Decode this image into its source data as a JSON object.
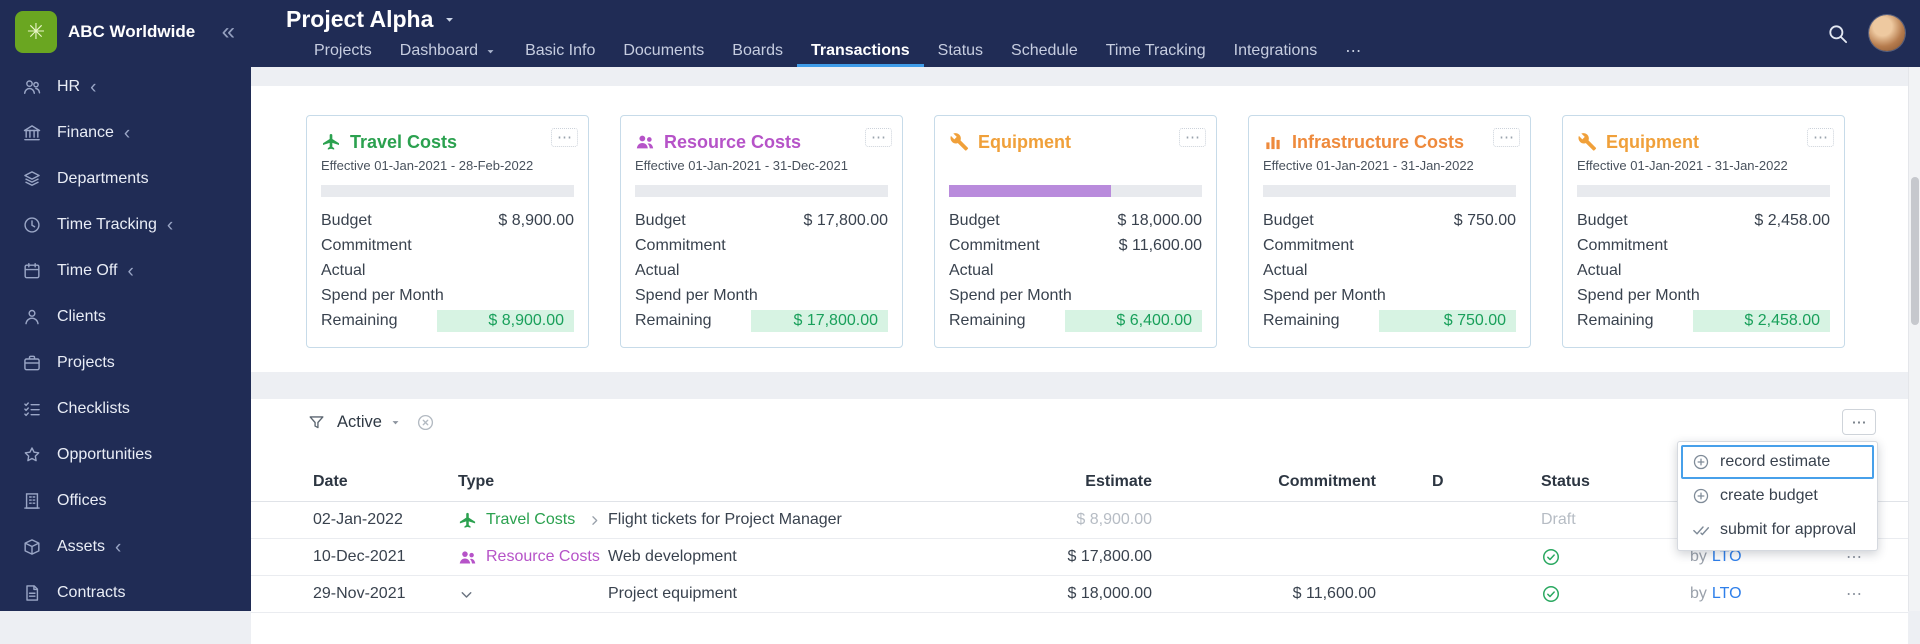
{
  "icons": {
    "logo_glyph": "✳",
    "collapse": "«",
    "expand_item": "‹",
    "more_horizontal": "⋯"
  },
  "sidebar": {
    "company": "ABC Worldwide",
    "items": [
      {
        "label": "HR"
      },
      {
        "label": "Finance"
      },
      {
        "label": "Departments"
      },
      {
        "label": "Time Tracking"
      },
      {
        "label": "Time Off"
      },
      {
        "label": "Clients"
      },
      {
        "label": "Projects"
      },
      {
        "label": "Checklists"
      },
      {
        "label": "Opportunities"
      },
      {
        "label": "Offices"
      },
      {
        "label": "Assets"
      },
      {
        "label": "Contracts"
      }
    ]
  },
  "header": {
    "title": "Project Alpha",
    "tabs": [
      "Projects",
      "Dashboard",
      "Basic Info",
      "Documents",
      "Boards",
      "Transactions",
      "Status",
      "Schedule",
      "Time Tracking",
      "Integrations",
      "⋯"
    ],
    "active_tab": "Transactions"
  },
  "card_labels": {
    "budget": "Budget",
    "commitment": "Commitment",
    "actual": "Actual",
    "spend": "Spend per Month",
    "remaining": "Remaining"
  },
  "cards": [
    {
      "title": "Travel Costs",
      "color": "#2ba14f",
      "effective": "Effective 01-Jan-2021 - 28-Feb-2022",
      "progress_pct": 0,
      "budget": "$ 8,900.00",
      "commitment": "",
      "actual": "",
      "spend_per_month": "",
      "remaining": "$ 8,900.00"
    },
    {
      "title": "Resource Costs",
      "color": "#b653c8",
      "effective": "Effective 01-Jan-2021 - 31-Dec-2021",
      "progress_pct": 0,
      "budget": "$ 17,800.00",
      "commitment": "",
      "actual": "",
      "spend_per_month": "",
      "remaining": "$ 17,800.00"
    },
    {
      "title": "Equipment",
      "color": "#f0a03a",
      "effective": "",
      "progress_pct": 64,
      "progress_color": "#b98bdc",
      "budget": "$ 18,000.00",
      "commitment": "$ 11,600.00",
      "actual": "",
      "spend_per_month": "",
      "remaining": "$ 6,400.00"
    },
    {
      "title": "Infrastructure Costs",
      "color": "#ee8a3c",
      "effective": "Effective 01-Jan-2021 - 31-Jan-2022",
      "progress_pct": 0,
      "budget": "$ 750.00",
      "commitment": "",
      "actual": "",
      "spend_per_month": "",
      "remaining": "$ 750.00"
    },
    {
      "title": "Equipment",
      "color": "#f0a03a",
      "effective": "Effective 01-Jan-2021 - 31-Jan-2022",
      "progress_pct": 0,
      "budget": "$ 2,458.00",
      "commitment": "",
      "actual": "",
      "spend_per_month": "",
      "remaining": "$ 2,458.00"
    }
  ],
  "filter": {
    "selected": "Active"
  },
  "table": {
    "headers": {
      "date": "Date",
      "type": "Type",
      "estimate": "Estimate",
      "commitment": "Commitment",
      "difference": "D",
      "status": "Status"
    },
    "rows": [
      {
        "date": "02-Jan-2022",
        "type": "Travel Costs",
        "description": "Flight tickets for Project Manager",
        "estimate": "$ 8,900.00",
        "commitment": "",
        "status": "Draft"
      },
      {
        "date": "10-Dec-2021",
        "type": "Resource Costs",
        "description": "Web development",
        "estimate": "$ 17,800.00",
        "commitment": "",
        "status": "approved",
        "by_prefix": "by",
        "by_user": "LTO"
      },
      {
        "date": "29-Nov-2021",
        "type": "",
        "description": "Project equipment",
        "estimate": "$ 18,000.00",
        "commitment": "$ 11,600.00",
        "status": "approved",
        "by_prefix": "by",
        "by_user": "LTO"
      }
    ]
  },
  "menu": {
    "items": [
      {
        "label": "record estimate",
        "selected": true
      },
      {
        "label": "create budget",
        "selected": false
      },
      {
        "label": "submit for approval",
        "selected": false
      }
    ]
  },
  "colors": {
    "navy": "#202c55",
    "accent_blue": "#3f9ce8",
    "remaining_bg": "#d7f3e3",
    "remaining_text": "#19a05b",
    "link_blue": "#2e7fea",
    "approved_green": "#2aa860"
  }
}
